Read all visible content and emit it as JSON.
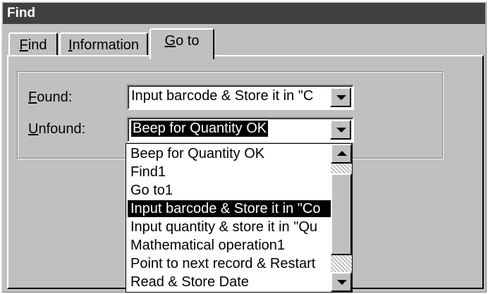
{
  "window": {
    "title": "Find"
  },
  "tabs": [
    {
      "accel": "F",
      "rest": "ind"
    },
    {
      "accel": "I",
      "rest": "nformation"
    },
    {
      "accel": "G",
      "rest": "o to"
    }
  ],
  "active_tab": "Go to",
  "found": {
    "label_accel": "F",
    "label_rest": "ound:",
    "value": "Input barcode & Store it in \"C"
  },
  "unfound": {
    "label_accel": "U",
    "label_rest": "nfound:",
    "value": "Beep for Quantity OK"
  },
  "dropdown_options": [
    "Beep for Quantity OK",
    "Find1",
    "Go to1",
    "Input barcode & Store it in \"Co",
    "Input quantity & store it in \"Qu",
    "Mathematical operation1",
    "Point to next record & Restart",
    "Read & Store Date"
  ],
  "highlighted_option": "Input barcode & Store it in \"Co",
  "icons": {
    "dropdown_arrow": "chevron-down-icon",
    "scroll_up": "arrow-up-icon",
    "scroll_down": "arrow-down-icon"
  },
  "colors": {
    "window_bg": "#c0c0c0",
    "titlebar_bg": "#404040",
    "highlight_bg": "#000000",
    "highlight_fg": "#ffffff"
  }
}
